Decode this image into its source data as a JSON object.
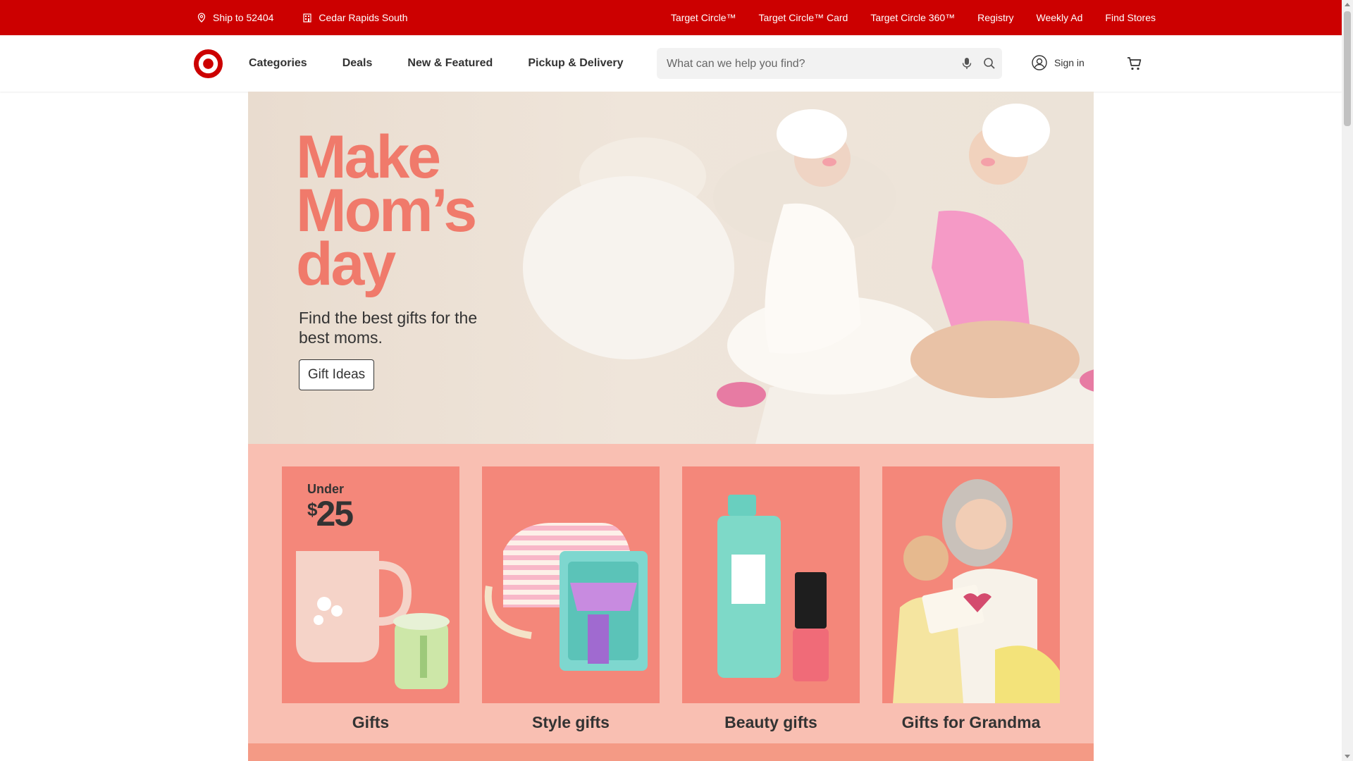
{
  "topbar": {
    "ship_to": "Ship to 52404",
    "store": "Cedar Rapids South",
    "links": [
      "Target Circle™",
      "Target Circle™ Card",
      "Target Circle 360™",
      "Registry",
      "Weekly Ad",
      "Find Stores"
    ]
  },
  "header": {
    "nav": [
      "Categories",
      "Deals",
      "New & Featured",
      "Pickup & Delivery"
    ],
    "search_placeholder": "What can we help you find?",
    "sign_in": "Sign in"
  },
  "hero": {
    "title_lines": [
      "Make",
      "Mom’s",
      "day"
    ],
    "subtitle": "Find the best gifts for the best moms.",
    "cta": "Gift Ideas"
  },
  "categories": [
    {
      "label": "Gifts",
      "badge_top": "Under",
      "badge_price_symbol": "$",
      "badge_price": "25"
    },
    {
      "label": "Style gifts"
    },
    {
      "label": "Beauty gifts"
    },
    {
      "label": "Gifts for Grandma"
    }
  ],
  "colors": {
    "brand_red": "#cc0000",
    "hero_title": "#f07a6b",
    "band_bg": "#f9bfb2",
    "card_bg": "#f4877a"
  }
}
